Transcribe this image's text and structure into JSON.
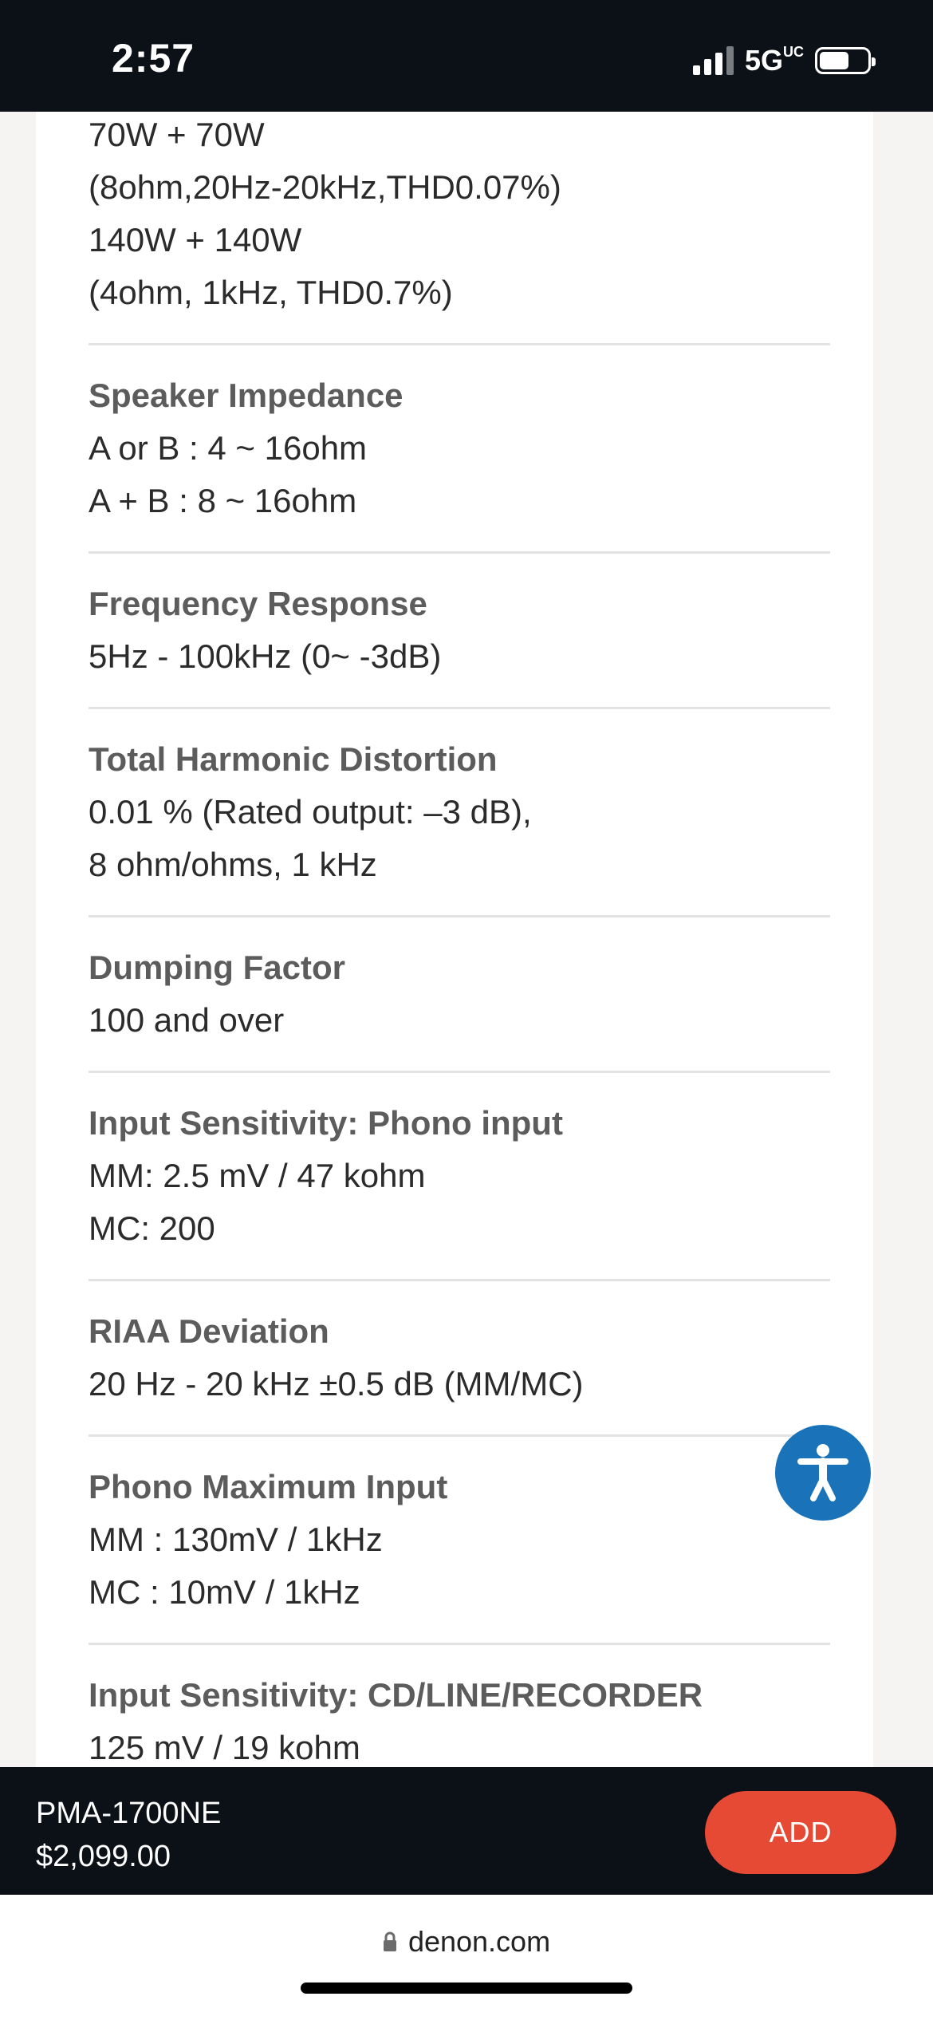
{
  "status_bar": {
    "time": "2:57",
    "network": "5G",
    "network_suffix": "UC",
    "battery_level": 0.62
  },
  "specs": [
    {
      "title": "",
      "lines": [
        "70W + 70W",
        "(8ohm,20Hz-20kHz,THD0.07%)",
        "140W + 140W",
        "(4ohm, 1kHz, THD0.7%)"
      ]
    },
    {
      "title": "Speaker Impedance",
      "lines": [
        "A or B : 4 ~ 16ohm",
        "A + B : 8 ~ 16ohm"
      ]
    },
    {
      "title": "Frequency Response",
      "lines": [
        "5Hz - 100kHz (0~ -3dB)"
      ]
    },
    {
      "title": "Total Harmonic Distortion",
      "lines": [
        "0.01 % (Rated output: –3 dB),",
        "8 ohm/ohms, 1 kHz"
      ]
    },
    {
      "title": "Dumping Factor",
      "lines": [
        "100 and over"
      ]
    },
    {
      "title": "Input Sensitivity: Phono input",
      "lines": [
        "MM: 2.5 mV / 47 kohm",
        "MC: 200"
      ]
    },
    {
      "title": "RIAA Deviation",
      "lines": [
        "20 Hz - 20 kHz ±0.5 dB (MM/MC)"
      ]
    },
    {
      "title": "Phono Maximum Input",
      "lines": [
        "MM : 130mV / 1kHz",
        "MC : 10mV / 1kHz"
      ]
    },
    {
      "title": "Input Sensitivity: CD/LINE/RECORDER",
      "lines": [
        "125 mV / 19 kohm"
      ]
    }
  ],
  "cart": {
    "product_name": "PMA-1700NE",
    "price": "$2,099.00",
    "add_label": "ADD"
  },
  "browser": {
    "url": "denon.com"
  },
  "icons": {
    "accessibility": "accessibility-icon",
    "lock": "lock-icon"
  },
  "colors": {
    "accent": "#e64a35",
    "accessibility": "#1a73b9",
    "dark_bar": "#0c1118"
  }
}
